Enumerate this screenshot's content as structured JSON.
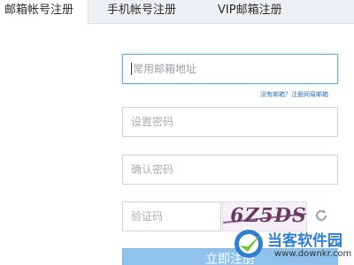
{
  "tabs": [
    {
      "label": "邮箱帐号注册",
      "active": true
    },
    {
      "label": "手机帐号注册",
      "active": false
    },
    {
      "label": "VIP邮箱注册",
      "active": false
    }
  ],
  "form": {
    "email_placeholder": "常用邮箱地址",
    "email_helper": "没有邮箱？注册网易邮箱",
    "password_placeholder": "设置密码",
    "confirm_placeholder": "确认密码",
    "captcha_placeholder": "验证码",
    "captcha_text": "6Z5DS",
    "submit_label": "立即注册"
  },
  "watermark": {
    "name": "当客软件园",
    "url": "www.downkr.com"
  },
  "colors": {
    "accent": "#6aa9e0",
    "button": "#8fc3ee",
    "link": "#2b6fb3"
  }
}
